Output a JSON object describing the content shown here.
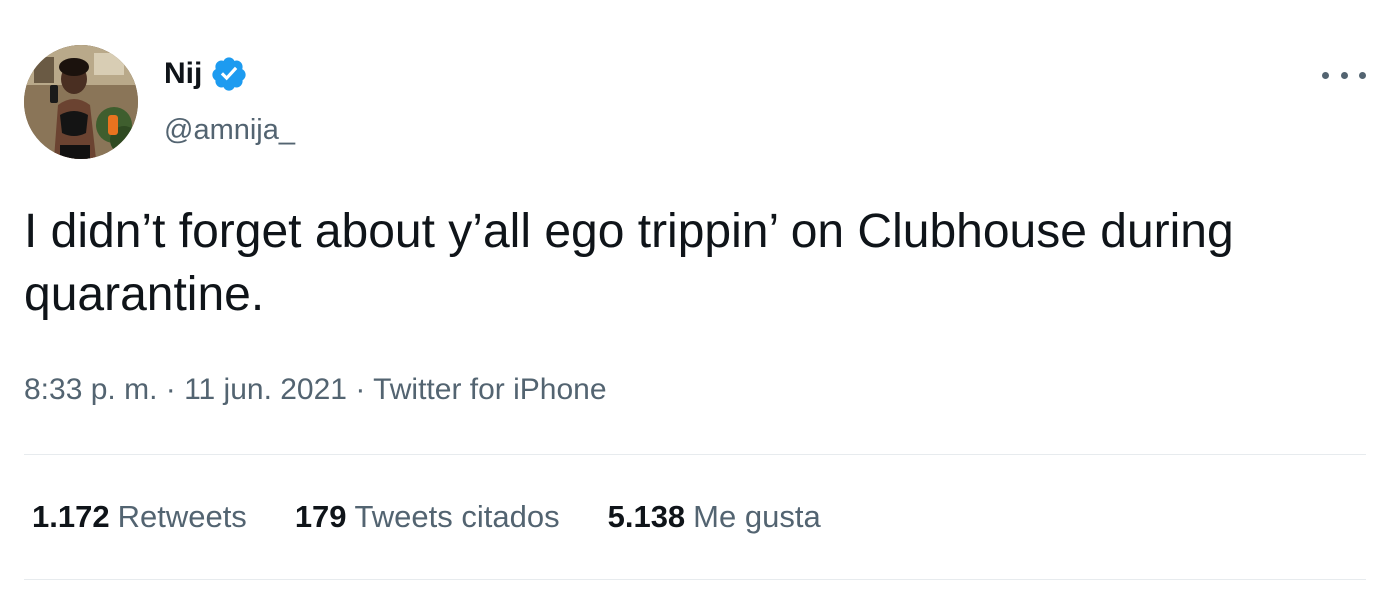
{
  "tweet": {
    "author": {
      "display_name": "Nij",
      "handle": "@amnija_",
      "verified_icon": "verified-badge-icon",
      "verified_color": "#1d9bf0"
    },
    "text": "I didn’t forget about y’all ego trippin’ on Clubhouse during quarantine.",
    "meta": "8:33 p. m. · 11 jun. 2021 · Twitter for iPhone",
    "more_icon": "more-options-icon",
    "stats": [
      {
        "count": "1.172",
        "label": "Retweets"
      },
      {
        "count": "179",
        "label": "Tweets citados"
      },
      {
        "count": "5.138",
        "label": "Me gusta"
      }
    ]
  },
  "colors": {
    "text_primary": "#0f1419",
    "text_secondary": "#536471",
    "divider": "#e7ebee"
  }
}
